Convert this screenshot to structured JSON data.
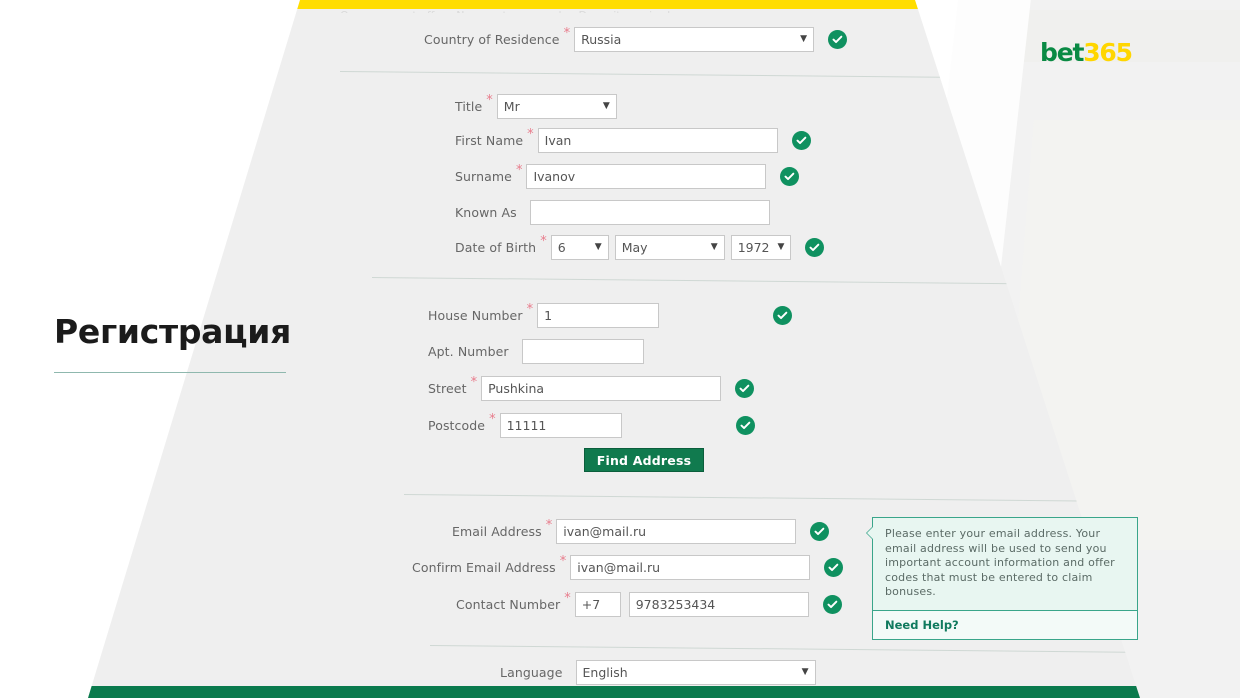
{
  "brand": {
    "logo_text_primary": "bet",
    "logo_text_secondary": "365",
    "green": "#0a8a44",
    "yellow": "#ffd600"
  },
  "page": {
    "title": "Регистрация"
  },
  "banner": {
    "clipped_text": "Open account offer   ·   New customers only   ·   Deposit required"
  },
  "form": {
    "required_marker": "*",
    "sections": [
      {
        "id": "residence",
        "fields": [
          {
            "label": "Country of Residence",
            "required": true,
            "type": "select",
            "value": "Russia",
            "valid": true
          }
        ]
      },
      {
        "id": "personal",
        "fields": [
          {
            "label": "Title",
            "required": true,
            "type": "select",
            "value": "Mr",
            "valid": false
          },
          {
            "label": "First Name",
            "required": true,
            "type": "text",
            "value": "Ivan",
            "valid": true
          },
          {
            "label": "Surname",
            "required": true,
            "type": "text",
            "value": "Ivanov",
            "valid": true
          },
          {
            "label": "Known As",
            "required": false,
            "type": "text",
            "value": "",
            "valid": false
          },
          {
            "label": "Date of Birth",
            "required": true,
            "type": "date",
            "day": "6",
            "month": "May",
            "year": "1972",
            "valid": true
          }
        ]
      },
      {
        "id": "address",
        "fields": [
          {
            "label": "House Number",
            "required": true,
            "type": "text",
            "value": "1",
            "valid": true
          },
          {
            "label": "Apt. Number",
            "required": false,
            "type": "text",
            "value": "",
            "valid": false
          },
          {
            "label": "Street",
            "required": true,
            "type": "text",
            "value": "Pushkina",
            "valid": true
          },
          {
            "label": "Postcode",
            "required": true,
            "type": "text",
            "value": "11111",
            "valid": true
          }
        ],
        "button": "Find Address"
      },
      {
        "id": "contact",
        "fields": [
          {
            "label": "Email Address",
            "required": true,
            "type": "text",
            "value": "ivan@mail.ru",
            "valid": true
          },
          {
            "label": "Confirm Email Address",
            "required": true,
            "type": "text",
            "value": "ivan@mail.ru",
            "valid": true
          },
          {
            "label": "Contact Number",
            "required": true,
            "type": "phone",
            "dial_code": "+7",
            "value": "9783253434",
            "valid": true
          }
        ]
      },
      {
        "id": "prefs",
        "fields": [
          {
            "label": "Language",
            "required": false,
            "type": "select",
            "value": "English",
            "valid": false
          }
        ]
      }
    ]
  },
  "tooltip": {
    "body": "Please enter your email address. Your email address will be used to send you important account information and offer codes that must be entered to claim bonuses.",
    "help_link": "Need Help?"
  },
  "icons": {
    "valid": "check-circle-icon",
    "dropdown": "▼"
  }
}
